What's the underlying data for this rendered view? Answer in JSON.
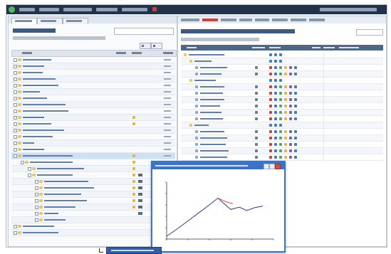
{
  "app": {
    "title": "",
    "user_info": ""
  },
  "topbar": {
    "items": [
      "",
      "",
      "",
      "",
      ""
    ]
  },
  "left_panel": {
    "tabs": [
      "",
      "",
      ""
    ],
    "title": "",
    "search_placeholder": "",
    "filters": "",
    "buttons": [
      "",
      ""
    ],
    "columns": [
      "",
      "",
      "",
      ""
    ],
    "rows": [
      {
        "label": ""
      },
      {
        "label": ""
      },
      {
        "label": ""
      },
      {
        "label": ""
      },
      {
        "label": ""
      },
      {
        "label": ""
      },
      {
        "label": ""
      },
      {
        "label": ""
      },
      {
        "label": ""
      },
      {
        "label": ""
      },
      {
        "label": ""
      },
      {
        "label": ""
      },
      {
        "label": ""
      },
      {
        "label": ""
      },
      {
        "label": ""
      },
      {
        "label": ""
      },
      {
        "label": ""
      },
      {
        "label": ""
      },
      {
        "label": ""
      },
      {
        "label": ""
      },
      {
        "label": ""
      },
      {
        "label": ""
      },
      {
        "label": ""
      },
      {
        "label": ""
      },
      {
        "label": ""
      },
      {
        "label": ""
      },
      {
        "label": ""
      },
      {
        "label": ""
      },
      {
        "label": ""
      },
      {
        "label": ""
      }
    ]
  },
  "right_panel": {
    "tabs": [
      "",
      "",
      "",
      "",
      "",
      "",
      "",
      ""
    ],
    "title": "",
    "select_value": "",
    "filters": "",
    "columns": [
      "",
      "",
      "",
      "",
      "",
      ""
    ],
    "rows": [
      {
        "label": ""
      },
      {
        "label": ""
      },
      {
        "label": ""
      },
      {
        "label": ""
      },
      {
        "label": ""
      },
      {
        "label": ""
      },
      {
        "label": ""
      },
      {
        "label": ""
      },
      {
        "label": ""
      },
      {
        "label": ""
      },
      {
        "label": ""
      },
      {
        "label": ""
      },
      {
        "label": ""
      },
      {
        "label": ""
      },
      {
        "label": ""
      },
      {
        "label": ""
      },
      {
        "label": ""
      },
      {
        "label": ""
      },
      {
        "label": ""
      },
      {
        "label": ""
      }
    ]
  },
  "popup": {
    "title": "",
    "chart_data": {
      "type": "line",
      "title": "",
      "xlabel": "",
      "ylabel": "",
      "xlim": [
        0,
        100
      ],
      "ylim": [
        0,
        100
      ],
      "series": [
        {
          "x": [
            0,
            10,
            20,
            30,
            40,
            48,
            55,
            60,
            68,
            75,
            82,
            90
          ],
          "y": [
            5,
            18,
            32,
            46,
            60,
            72,
            60,
            52,
            56,
            50,
            55,
            58
          ],
          "color": "#2b3a8f"
        },
        {
          "x": [
            48,
            55,
            62
          ],
          "y": [
            72,
            66,
            62
          ],
          "color": "#d94a4a"
        }
      ]
    }
  },
  "taskbar": {
    "item": ""
  },
  "colors": {
    "topbar": "#21324b",
    "accent": "#3b73c9",
    "selection": "#cfe0f4",
    "folder": "#e7c96a"
  }
}
